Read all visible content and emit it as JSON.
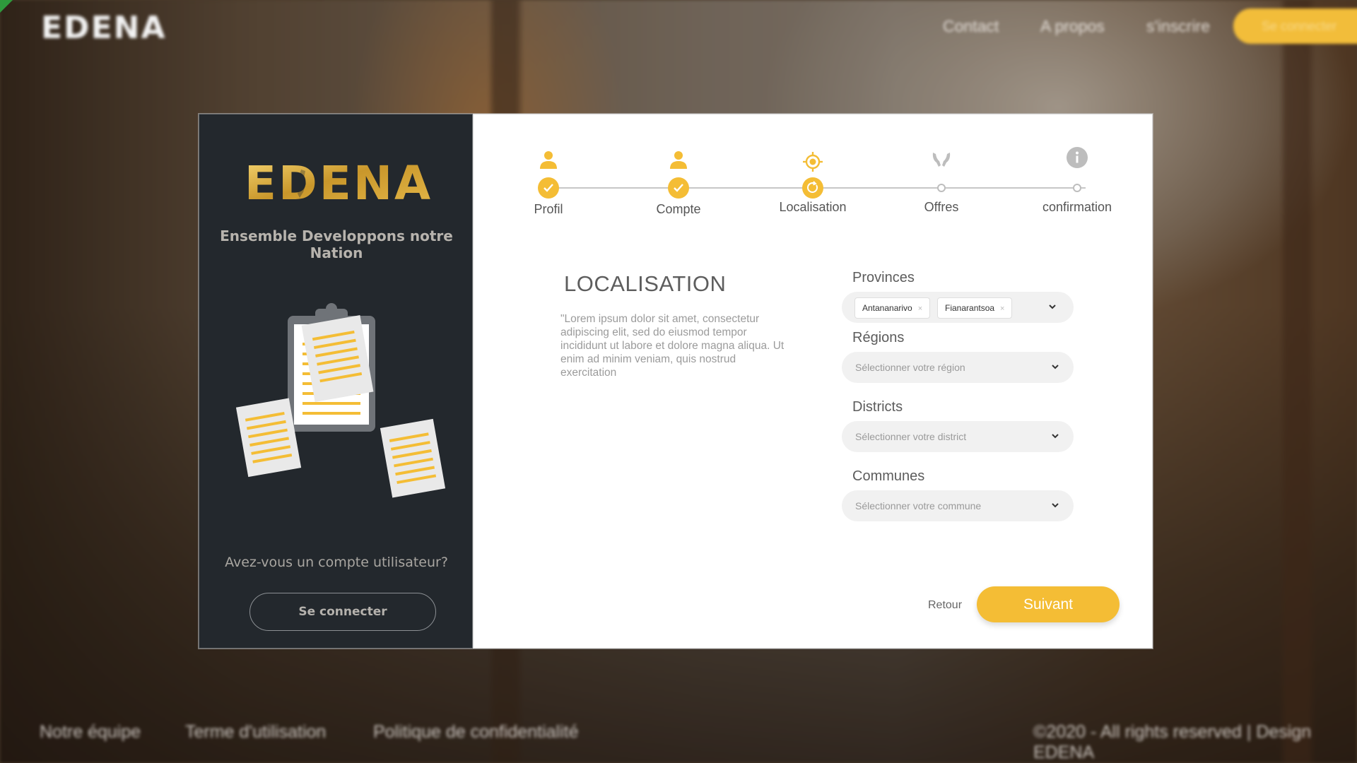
{
  "background": {
    "logo": "EDENA",
    "nav": [
      "Contact",
      "A propos",
      "s'inscrire"
    ],
    "login_label": "Se connecter",
    "footer_links": [
      "Notre équipe",
      "Terme d'utilisation",
      "Politique de confidentialité"
    ],
    "copyright": "©2020 - All rights reserved | Design EDENA"
  },
  "left_panel": {
    "brand": "EDENA",
    "tagline": "Ensemble Developpons notre Nation",
    "account_question": "Avez-vous un compte utilisateur?",
    "login_button": "Se connecter"
  },
  "stepper": {
    "steps": [
      {
        "label": "Profil",
        "status": "done",
        "icon": "user-icon"
      },
      {
        "label": "Compte",
        "status": "done",
        "icon": "user-icon"
      },
      {
        "label": "Localisation",
        "status": "current",
        "icon": "location-target-icon"
      },
      {
        "label": "Offres",
        "status": "todo",
        "icon": "hands-icon"
      },
      {
        "label": "confirmation",
        "status": "todo",
        "icon": "info-icon"
      }
    ]
  },
  "form": {
    "title": "LOCALISATION",
    "description": "\"Lorem ipsum dolor sit amet, consectetur adipiscing elit, sed do eiusmod tempor incididunt ut labore et dolore magna aliqua. Ut enim ad minim veniam, quis nostrud exercitation",
    "provinces": {
      "label": "Provinces",
      "selected": [
        "Antananarivo",
        "Fianarantsoa"
      ]
    },
    "regions": {
      "label": "Régions",
      "placeholder": "Sélectionner votre région"
    },
    "districts": {
      "label": "Districts",
      "placeholder": "Sélectionner votre district"
    },
    "communes": {
      "label": "Communes",
      "placeholder": "Sélectionner votre commune"
    },
    "back_label": "Retour",
    "next_label": "Suivant"
  },
  "colors": {
    "accent": "#f4bd35",
    "left_panel_bg": "#23282d",
    "muted_text": "#9b9b9b"
  }
}
